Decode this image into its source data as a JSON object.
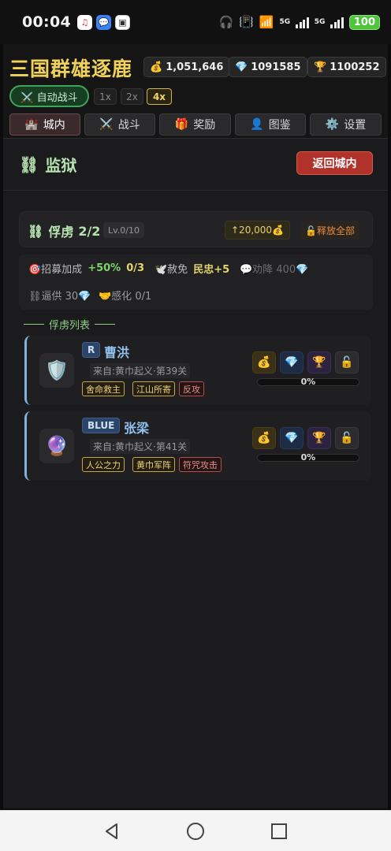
{
  "status_bar": {
    "time": "00:04",
    "net1": "5G",
    "net2": "5G",
    "battery": "100",
    "app_icons": [
      "music-app-icon",
      "message-app-icon",
      "gallery-app-icon"
    ]
  },
  "header": {
    "game_title": "三国群雄逐鹿",
    "resources": [
      {
        "icon": "💰",
        "value": "1,051,646"
      },
      {
        "icon": "💎",
        "value": "1091585"
      },
      {
        "icon": "🏆",
        "value": "1100252"
      }
    ],
    "auto_battle_label": "⚔️ 自动战斗",
    "speeds": [
      "1x",
      "2x",
      "4x"
    ],
    "active_speed": "4x",
    "nav": [
      {
        "icon": "🏰",
        "label": "城内",
        "active": true
      },
      {
        "icon": "⚔️",
        "label": "战斗",
        "active": false
      },
      {
        "icon": "🎁",
        "label": "奖励",
        "active": false
      },
      {
        "icon": "👤",
        "label": "图鉴",
        "active": false
      },
      {
        "icon": "⚙️",
        "label": "设置",
        "active": false
      }
    ]
  },
  "page": {
    "icon": "⛓",
    "title": "监狱",
    "back_label": "返回城内"
  },
  "prisoner_panel": {
    "icon": "⛓",
    "title": "俘虏",
    "count": "2/2",
    "level": "Lv.0/10",
    "upgrade_cost": "↑20,000💰",
    "release_all": "🔓释放全部"
  },
  "stats": {
    "recruit_label": "🎯招募加成",
    "recruit_value": "+50%",
    "recruit_count": "0/3",
    "pardon_label": "🕊️赦免",
    "pardon_value": "民忠+5",
    "persuade": "💬劝降 400💎",
    "coerce": "⛓逼供 30💎",
    "inspire": "🤝感化 0/1"
  },
  "list_label": "俘虏列表",
  "prisoners": [
    {
      "avatar": "🛡️",
      "rarity": "R",
      "name": "曹洪",
      "from": "来自:黄巾起义·第39关",
      "tags": [
        "舍命救主",
        "江山所寄",
        "反攻"
      ],
      "tag_colors": [
        "gold",
        "gold",
        "red"
      ],
      "progress": 0,
      "progress_text": "0%"
    },
    {
      "avatar": "🔮",
      "rarity": "BLUE",
      "name": "张梁",
      "from": "来自:黄巾起义·第41关",
      "tags": [
        "人公之力",
        "黄巾军阵",
        "符咒攻击"
      ],
      "tag_colors": [
        "gold",
        "gold",
        "red"
      ],
      "progress": 0,
      "progress_text": "0%"
    }
  ],
  "card_actions": [
    "💰",
    "💎",
    "🏆",
    "🔓"
  ],
  "colors": {
    "title_gold": "#f0d15a",
    "accent_green": "#7ed36a",
    "back_red": "#b0322a",
    "card_border": "#7fb2e0"
  }
}
